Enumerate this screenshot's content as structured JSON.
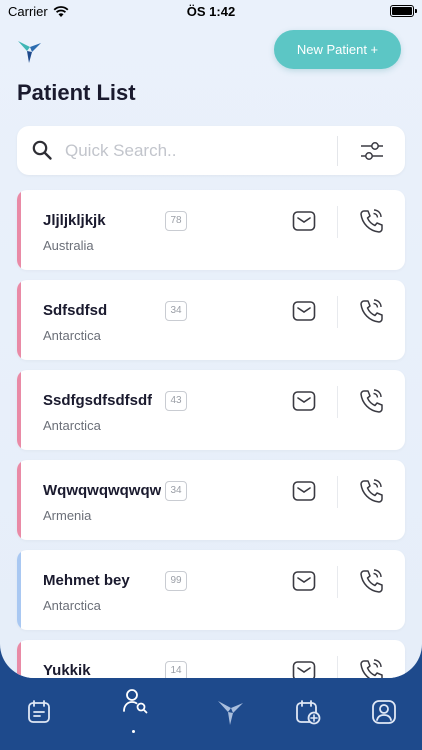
{
  "status_bar": {
    "carrier": "Carrier",
    "time": "ÖS 1:42"
  },
  "header": {
    "new_patient_label": "New Patient +",
    "title": "Patient List"
  },
  "search": {
    "placeholder": "Quick Search.."
  },
  "colors": {
    "accent_teal": "#5cc6c5",
    "accent_pink": "#e98aa6",
    "accent_blue": "#a9c8f2",
    "tabbar": "#1e4a8c"
  },
  "patients": [
    {
      "name": "Jljljkljkjk",
      "age": "78",
      "country": "Australia",
      "accent": "pink"
    },
    {
      "name": "Sdfsdfsd",
      "age": "34",
      "country": "Antarctica",
      "accent": "pink"
    },
    {
      "name": "Ssdfgsdfsdfsdf",
      "age": "43",
      "country": "Antarctica",
      "accent": "pink"
    },
    {
      "name": "Wqwqwqwqwqw",
      "age": "34",
      "country": "Armenia",
      "accent": "pink"
    },
    {
      "name": "Mehmet bey",
      "age": "99",
      "country": "Antarctica",
      "accent": "blue"
    },
    {
      "name": "Yukkik",
      "age": "14",
      "country": "",
      "accent": "pink"
    }
  ],
  "tabbar": {
    "items": [
      {
        "icon": "calendar-icon"
      },
      {
        "icon": "patient-search-icon",
        "active": true
      },
      {
        "icon": "brand-logo-icon"
      },
      {
        "icon": "calendar-add-icon"
      },
      {
        "icon": "profile-icon"
      }
    ]
  }
}
